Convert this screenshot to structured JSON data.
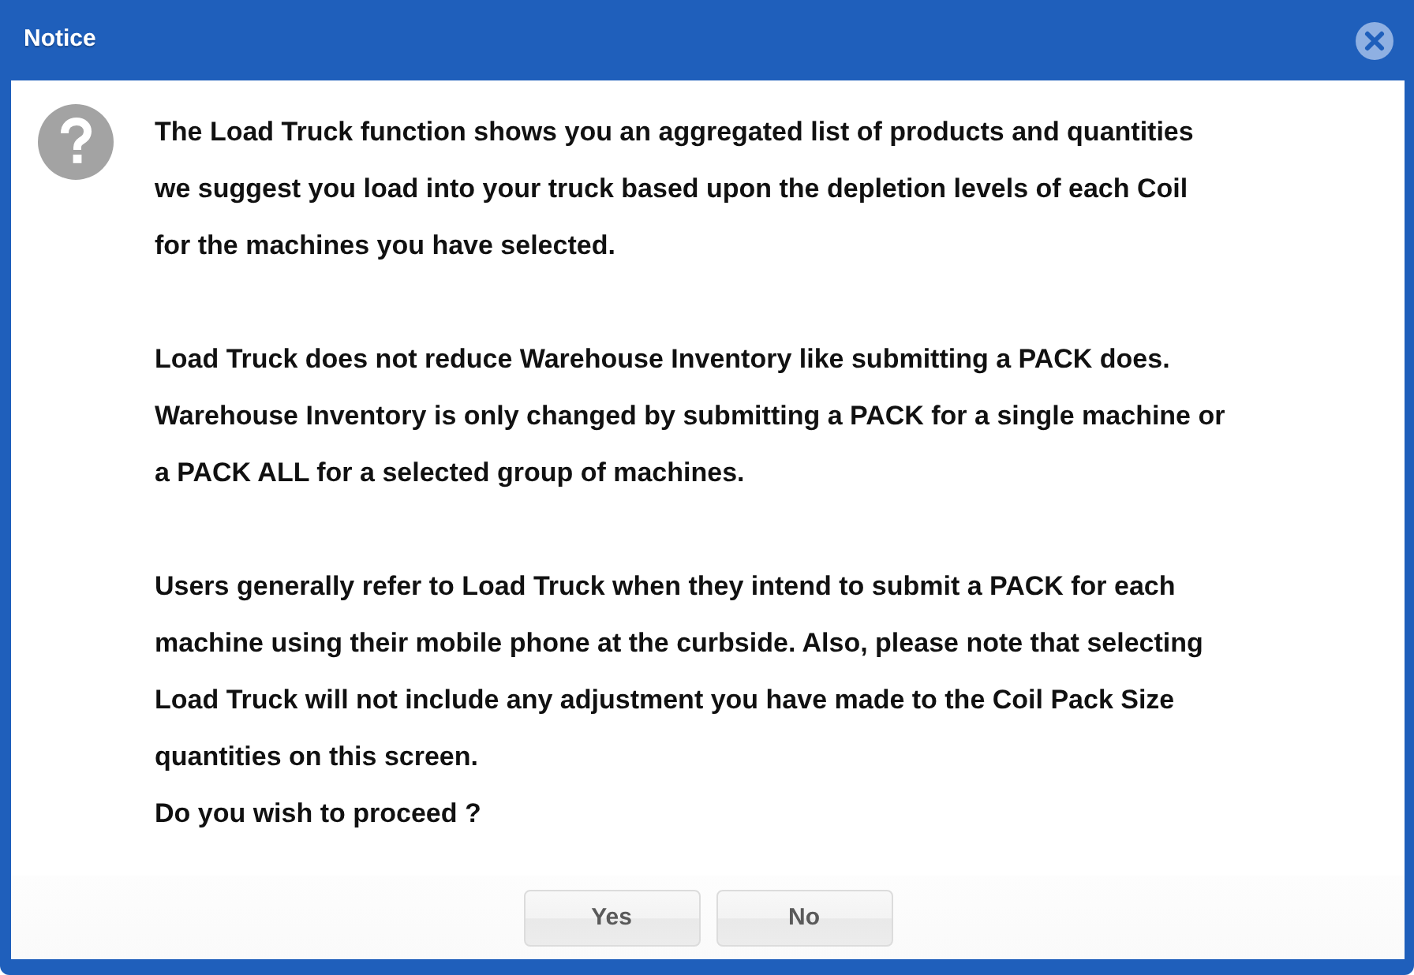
{
  "window": {
    "title": "Notice"
  },
  "message": {
    "paragraphs": [
      {
        "lines": [
          "The Load Truck function shows you an aggregated list of products and quantities",
          "we suggest you load into your truck based upon the depletion levels of each Coil",
          "for the machines you have selected."
        ]
      },
      {
        "lines": [
          "Load Truck does not reduce Warehouse Inventory like submitting a PACK does.",
          "Warehouse Inventory is only changed by submitting a PACK for a single machine or",
          "a PACK ALL for a selected group of machines."
        ]
      },
      {
        "lines": [
          "Users generally refer to Load Truck when they intend to submit a PACK for each",
          "machine using their mobile phone at the curbside. Also, please note that selecting",
          "Load Truck will not include any adjustment you have made to the Coil Pack Size",
          "quantities on this screen."
        ]
      }
    ],
    "question": "Do you wish to proceed ?"
  },
  "buttons": [
    "Yes",
    "No"
  ]
}
